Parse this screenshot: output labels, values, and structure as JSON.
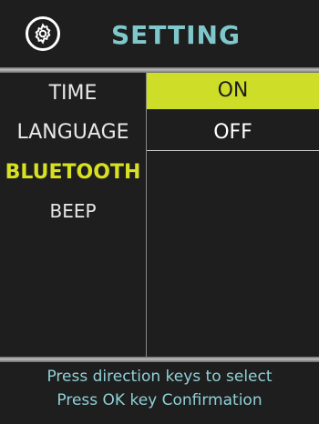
{
  "header": {
    "title": "SETTING",
    "icon": "gear-icon"
  },
  "menu": {
    "items": [
      {
        "label": "TIME"
      },
      {
        "label": "LANGUAGE"
      },
      {
        "label": "BLUETOOTH"
      },
      {
        "label": "BEEP"
      }
    ],
    "active": "BLUETOOTH"
  },
  "options": {
    "items": [
      {
        "label": "ON"
      },
      {
        "label": "OFF"
      }
    ],
    "selected": "ON"
  },
  "footer": {
    "line1": "Press direction keys to select",
    "line2": "Press OK key Confirmation"
  },
  "colors": {
    "background": "#1e1e1e",
    "title": "#7ec8cc",
    "active_text": "#d8e022",
    "selected_bg": "#cedd28",
    "hint_text": "#8fd0d6"
  }
}
